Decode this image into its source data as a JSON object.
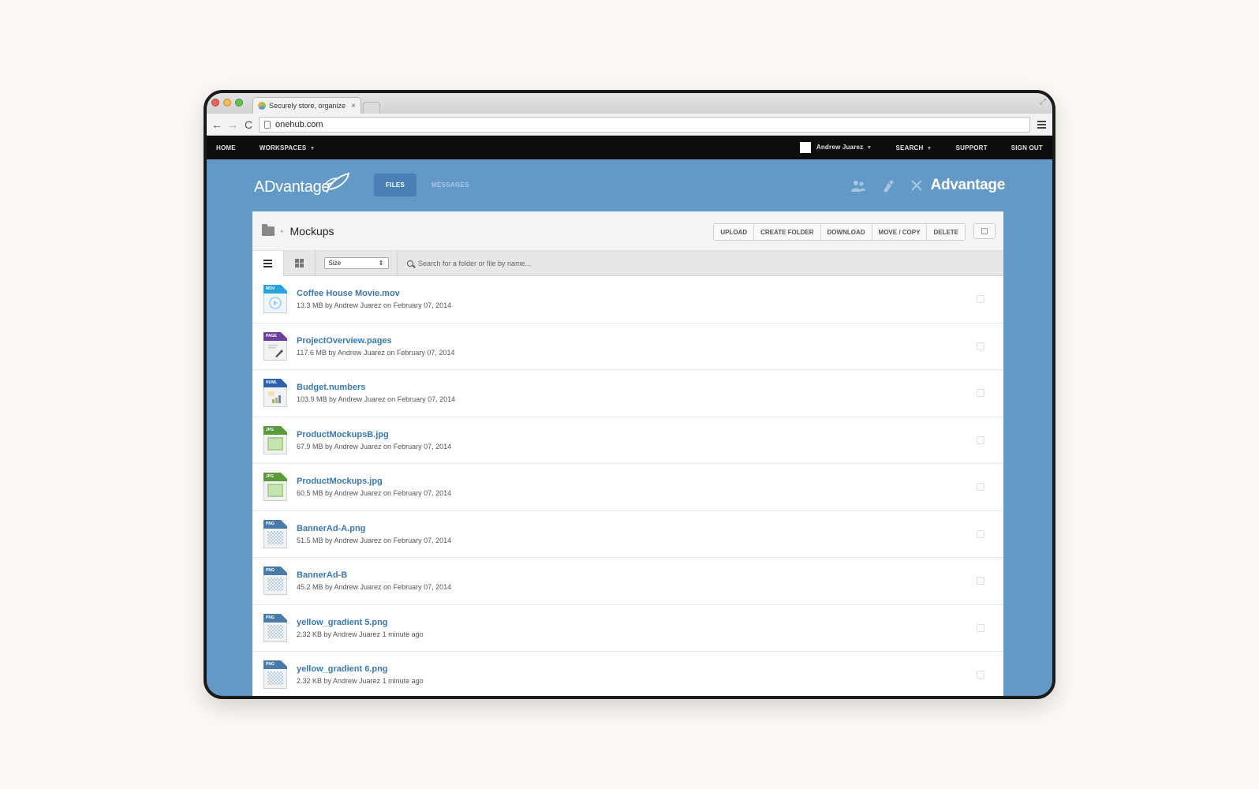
{
  "browser": {
    "tab_title": "Securely store, organize a",
    "tab_close": "×",
    "url": "onehub.com",
    "back": "←",
    "forward": "→",
    "reload": "C"
  },
  "topnav": {
    "home": "HOME",
    "workspaces": "WORKSPACES",
    "user": "Andrew Juarez",
    "search": "SEARCH",
    "support": "SUPPORT",
    "sign_out": "SIGN OUT",
    "caret": "▼"
  },
  "brand": {
    "logo": "ADvantage",
    "workspace_name": "Advantage",
    "tabs": {
      "files": "FILES",
      "messages": "MESSAGES"
    },
    "accent_color": "#6399c7"
  },
  "panel": {
    "breadcrumb_sep": "▸",
    "title": "Mockups",
    "actions": [
      "UPLOAD",
      "CREATE FOLDER",
      "DOWNLOAD",
      "MOVE / COPY",
      "DELETE"
    ],
    "sort_value": "Size",
    "sort_arrow": "⇕",
    "search_placeholder": "Search for a folder or file by name..."
  },
  "files": [
    {
      "type": "MOV",
      "name": "Coffee House Movie.mov",
      "meta": "13.3 MB by Andrew Juarez on February 07, 2014",
      "icon": "video-file-icon",
      "band": "#29a3de"
    },
    {
      "type": "PAGE",
      "name": "ProjectOverview.pages",
      "meta": "117.6 MB by Andrew Juarez on February 07, 2014",
      "icon": "pages-file-icon",
      "band": "#6f3f9e"
    },
    {
      "type": "NUML",
      "name": "Budget.numbers",
      "meta": "103.9 MB by Andrew Juarez on February 07, 2014",
      "icon": "numbers-file-icon",
      "band": "#2d62a8"
    },
    {
      "type": "JPG",
      "name": "ProductMockupsB.jpg",
      "meta": "67.9 MB by Andrew Juarez on February 07, 2014",
      "icon": "jpg-file-icon",
      "band": "#5a9a3c"
    },
    {
      "type": "JPG",
      "name": "ProductMockups.jpg",
      "meta": "60.5 MB by Andrew Juarez on February 07, 2014",
      "icon": "jpg-file-icon",
      "band": "#5a9a3c"
    },
    {
      "type": "PNG",
      "name": "BannerAd-A.png",
      "meta": "51.5 MB by Andrew Juarez on February 07, 2014",
      "icon": "png-file-icon",
      "band": "#4a7ba8"
    },
    {
      "type": "PNG",
      "name": "BannerAd-B",
      "meta": "45.2 MB by Andrew Juarez on February 07, 2014",
      "icon": "png-file-icon",
      "band": "#4a7ba8"
    },
    {
      "type": "PNG",
      "name": "yellow_gradient 5.png",
      "meta": "2.32 KB by Andrew Juarez 1 minute ago",
      "icon": "png-file-icon",
      "band": "#4a7ba8"
    },
    {
      "type": "PNG",
      "name": "yellow_gradient 6.png",
      "meta": "2.32 KB by Andrew Juarez 1 minute ago",
      "icon": "png-file-icon",
      "band": "#4a7ba8"
    }
  ]
}
